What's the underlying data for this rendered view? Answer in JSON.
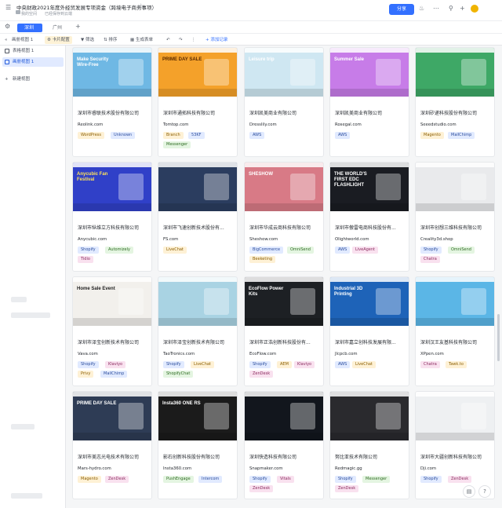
{
  "header": {
    "title": "中央财政2021年度外经贸发展专项资金（跨境电子商务事项）",
    "location": "我的空间",
    "save_status": "已经保存到云端",
    "share_label": "分享"
  },
  "tabs": [
    {
      "label": "深圳"
    },
    {
      "label": "广州"
    }
  ],
  "toolbar": {
    "view_label": "画册视图 1",
    "card_config_label": "卡片配置",
    "filter_label": "筛选",
    "sort_label": "排序",
    "generate_label": "生成表单",
    "add_record_label": "+ 添加记录"
  },
  "sidebar": {
    "items": [
      {
        "label": "表格视图 1"
      },
      {
        "label": "画册视图 1"
      }
    ],
    "new_view_label": "新建视图"
  },
  "cards": [
    {
      "title": "深圳市睿联技术股份有限公司",
      "url": "Reolink.com",
      "tags": [
        "WordPress",
        "Unknown"
      ]
    },
    {
      "title": "深圳市通拓科技有限公司",
      "url": "Tomtop.com",
      "tags": [
        "Branch",
        "53KF",
        "Messenger"
      ]
    },
    {
      "title": "深圳凯美商业有限公司",
      "url": "Dresslily.com",
      "tags": [
        "AWS"
      ]
    },
    {
      "title": "深圳凯美商业有限公司",
      "url": "Rosegal.com",
      "tags": [
        "AWS"
      ]
    },
    {
      "title": "深圳矽递科技股份有限公司",
      "url": "Seeedstudio.com",
      "tags": [
        "Magento",
        "MailChimp"
      ]
    },
    {
      "title": "深圳市纵维立方科技有限公司",
      "url": "Anycubic.com",
      "tags": [
        "Shopify",
        "Automizely",
        "Tidio"
      ]
    },
    {
      "title": "深圳市飞速创新技术股份有...",
      "url": "FS.com",
      "tags": [
        "LiveChat"
      ]
    },
    {
      "title": "深圳市华成云商科技有限公司",
      "url": "Sheshow.com",
      "tags": [
        "BigCommerce",
        "OmniSend",
        "Beeketing"
      ]
    },
    {
      "title": "深圳市傲雷电商科技股份有...",
      "url": "Olightworld.com",
      "tags": [
        "AWS",
        "LiveAgent"
      ]
    },
    {
      "title": "深圳市创想三维科技有限公司",
      "url": "Creality3d.shop",
      "tags": [
        "Shopify",
        "OmniSend",
        "Chatra"
      ]
    },
    {
      "title": "深圳市泽宝创新技术有限公司",
      "url": "Vava.com",
      "tags": [
        "Shopify",
        "Klaviyo",
        "Privy",
        "MailChimp"
      ]
    },
    {
      "title": "深圳市泽宝创新技术有限公司",
      "url": "TaoTronics.com",
      "tags": [
        "Shopify",
        "LiveChat",
        "ShopifyChat"
      ]
    },
    {
      "title": "深圳市正浩创新科技股份有...",
      "url": "EcoFlow.com",
      "tags": [
        "Shopify",
        "AEM",
        "Klaviyo",
        "ZenDesk"
      ]
    },
    {
      "title": "深圳市嘉立创科技发展有限...",
      "url": "Jlcpcb.com",
      "tags": [
        "AWS",
        "LiveChat"
      ]
    },
    {
      "title": "深圳汉王友基科技有限公司",
      "url": "XPpen.com",
      "tags": [
        "Chatra",
        "Tawk.to"
      ]
    },
    {
      "title": "深圳市美志光电技术有限公司",
      "url": "Mars-hydro.com",
      "tags": [
        "Magento",
        "ZenDesk"
      ]
    },
    {
      "title": "影石创新科技股份有限公司",
      "url": "Insta360.com",
      "tags": [
        "PushEngage",
        "Intercom"
      ]
    },
    {
      "title": "深圳快造科技有限公司",
      "url": "Snapmaker.com",
      "tags": [
        "Shopify",
        "Vitals",
        "ZenDesk"
      ]
    },
    {
      "title": "努比亚技术有限公司",
      "url": "Redmagic.gg",
      "tags": [
        "Shopify",
        "Messenger",
        "ZenDesk"
      ]
    },
    {
      "title": "深圳市大疆创新科技有限公司",
      "url": "Dji.com",
      "tags": [
        "Shopify",
        "ZenDesk"
      ]
    }
  ],
  "thumbs": [
    {
      "headline": "Make Security Wire-Free",
      "bg": "#6fb8e4",
      "fg": "#ffffff"
    },
    {
      "headline": "PRIME DAY SALE",
      "bg": "#f4a12a",
      "fg": "#5a2a00"
    },
    {
      "headline": "Leisure trip",
      "bg": "#cfe7f2",
      "fg": "#ffffff"
    },
    {
      "headline": "Summer Sale",
      "bg": "#c77ce8",
      "fg": "#ffffff"
    },
    {
      "headline": "",
      "bg": "#3ea866",
      "fg": "#ffffff"
    },
    {
      "headline": "Anycubic Fan Festival",
      "bg": "#3040c8",
      "fg": "#ffe25a"
    },
    {
      "headline": "",
      "bg": "#2b3d5f",
      "fg": "#ffffff"
    },
    {
      "headline": "SHESHOW",
      "bg": "#d87a86",
      "fg": "#ffffff"
    },
    {
      "headline": "THE WORLD'S FIRST EDC FLASHLIGHT",
      "bg": "#1a1c22",
      "fg": "#ffffff"
    },
    {
      "headline": "",
      "bg": "#e9eaec",
      "fg": "#333333"
    },
    {
      "headline": "Home Sale Event",
      "bg": "#f2f0ec",
      "fg": "#222222"
    },
    {
      "headline": "",
      "bg": "#a9d3e3",
      "fg": "#ffffff"
    },
    {
      "headline": "EcoFlow Power Kits",
      "bg": "#1d2024",
      "fg": "#ffffff"
    },
    {
      "headline": "Industrial 3D Printing",
      "bg": "#1e63b8",
      "fg": "#ffffff"
    },
    {
      "headline": "",
      "bg": "#5bb6e6",
      "fg": "#ffffff"
    },
    {
      "headline": "PRIME DAY SALE",
      "bg": "#2e3c55",
      "fg": "#ffffff"
    },
    {
      "headline": "Insta360 ONE RS",
      "bg": "#1b1b1b",
      "fg": "#ffffff"
    },
    {
      "headline": "",
      "bg": "#12161d",
      "fg": "#ffffff"
    },
    {
      "headline": "",
      "bg": "#2a2a2e",
      "fg": "#ffffff"
    },
    {
      "headline": "",
      "bg": "#eef0f2",
      "fg": "#222222"
    }
  ],
  "colors": {
    "accent": "#3370ff"
  }
}
